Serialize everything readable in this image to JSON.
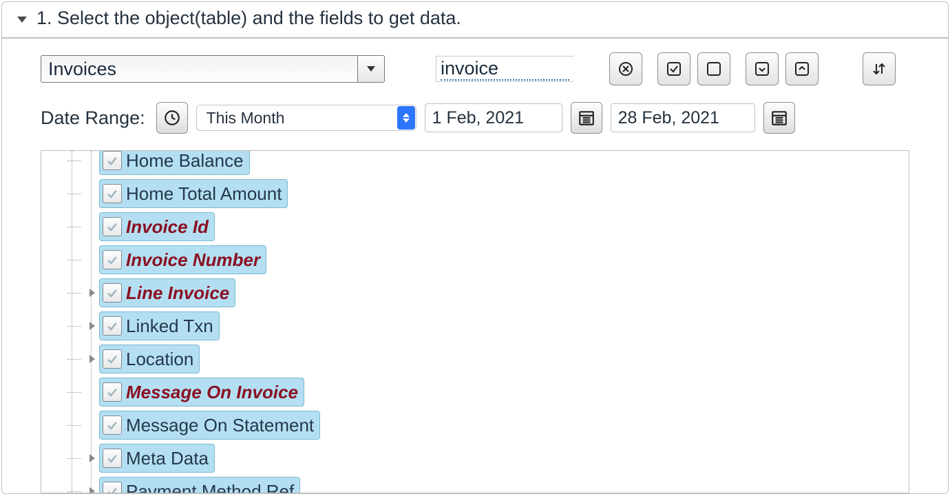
{
  "header": {
    "title": "1. Select the object(table) and the fields to get data."
  },
  "object_select": {
    "value": "Invoices"
  },
  "filter": {
    "value": "invoice"
  },
  "date_range": {
    "label": "Date Range:",
    "preset": "This Month",
    "start": "1 Feb, 2021",
    "end": "28 Feb, 2021"
  },
  "tree": {
    "items": [
      {
        "label": "Home Balance",
        "highlight": false,
        "expandable": false,
        "checked": true
      },
      {
        "label": "Home Total Amount",
        "highlight": false,
        "expandable": false,
        "checked": true
      },
      {
        "label": "Invoice Id",
        "highlight": true,
        "expandable": false,
        "checked": true
      },
      {
        "label": "Invoice Number",
        "highlight": true,
        "expandable": false,
        "checked": true
      },
      {
        "label": "Line Invoice",
        "highlight": true,
        "expandable": true,
        "checked": true
      },
      {
        "label": "Linked Txn",
        "highlight": false,
        "expandable": true,
        "checked": true
      },
      {
        "label": "Location",
        "highlight": false,
        "expandable": true,
        "checked": true
      },
      {
        "label": "Message On Invoice",
        "highlight": true,
        "expandable": false,
        "checked": true
      },
      {
        "label": "Message On Statement",
        "highlight": false,
        "expandable": false,
        "checked": true
      },
      {
        "label": "Meta Data",
        "highlight": false,
        "expandable": true,
        "checked": true
      },
      {
        "label": "Payment Method Ref",
        "highlight": false,
        "expandable": true,
        "checked": true
      }
    ]
  }
}
